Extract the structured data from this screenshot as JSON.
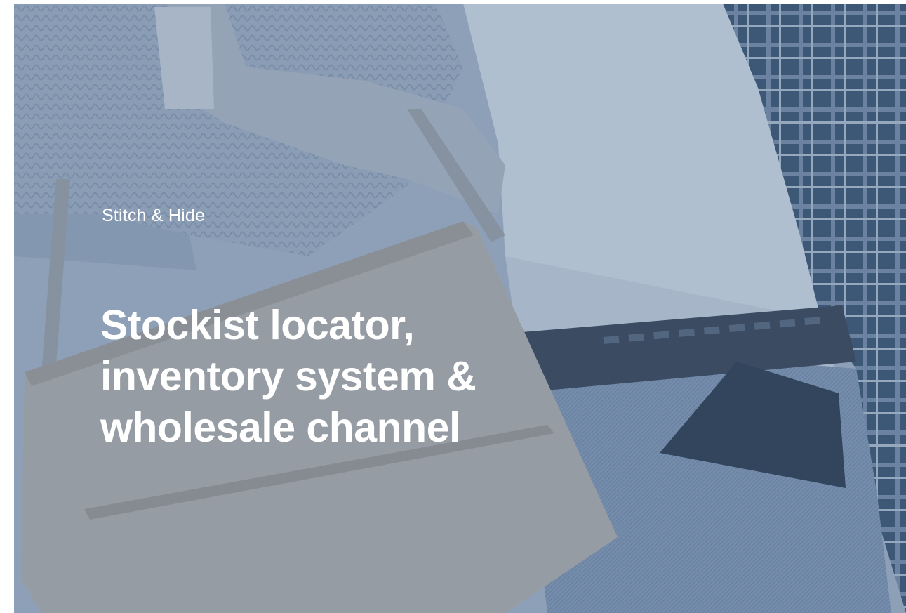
{
  "hero": {
    "brand": "Stitch & Hide",
    "headline_lines": [
      "Stockist locator,",
      "inventory system &",
      "wholesale channel"
    ],
    "overlay_color": "#3d5a80",
    "text_color": "#ffffff"
  }
}
